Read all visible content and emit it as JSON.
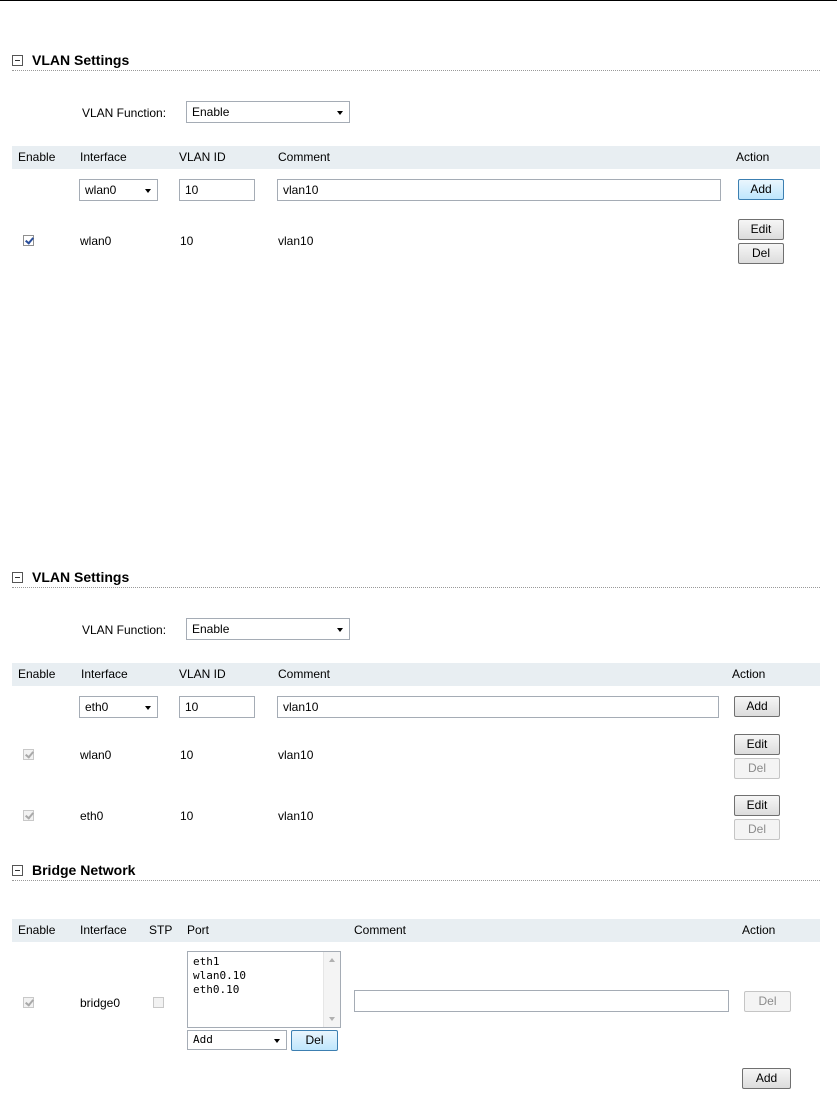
{
  "vlan1": {
    "title": "VLAN Settings",
    "function_label": "VLAN Function:",
    "function_value": "Enable",
    "headers": {
      "enable": "Enable",
      "interface": "Interface",
      "vlan_id": "VLAN ID",
      "comment": "Comment",
      "action": "Action"
    },
    "new_row": {
      "interface": "wlan0",
      "vlan_id": "10",
      "comment": "vlan10",
      "add_label": "Add"
    },
    "rows": [
      {
        "enabled": true,
        "interface": "wlan0",
        "vlan_id": "10",
        "comment": "vlan10",
        "edit_label": "Edit",
        "del_label": "Del"
      }
    ]
  },
  "vlan2": {
    "title": "VLAN Settings",
    "function_label": "VLAN Function:",
    "function_value": "Enable",
    "headers": {
      "enable": "Enable",
      "interface": "Interface",
      "vlan_id": "VLAN ID",
      "comment": "Comment",
      "action": "Action"
    },
    "new_row": {
      "interface": "eth0",
      "vlan_id": "10",
      "comment": "vlan10",
      "add_label": "Add"
    },
    "rows": [
      {
        "enabled": true,
        "interface": "wlan0",
        "vlan_id": "10",
        "comment": "vlan10",
        "edit_label": "Edit",
        "del_label": "Del"
      },
      {
        "enabled": true,
        "interface": "eth0",
        "vlan_id": "10",
        "comment": "vlan10",
        "edit_label": "Edit",
        "del_label": "Del"
      }
    ]
  },
  "bridge": {
    "title": "Bridge Network",
    "headers": {
      "enable": "Enable",
      "interface": "Interface",
      "stp": "STP",
      "port": "Port",
      "comment": "Comment",
      "action": "Action"
    },
    "rows": [
      {
        "enabled": true,
        "interface": "bridge0",
        "stp": false,
        "ports": [
          "eth1",
          "wlan0.10",
          "eth0.10"
        ],
        "port_select": "Add",
        "port_del_label": "Del",
        "comment": "",
        "del_label": "Del"
      }
    ],
    "add_label": "Add"
  },
  "colors": {
    "header_bg": "#e8eef2",
    "focus_border": "#3c7fb1"
  }
}
